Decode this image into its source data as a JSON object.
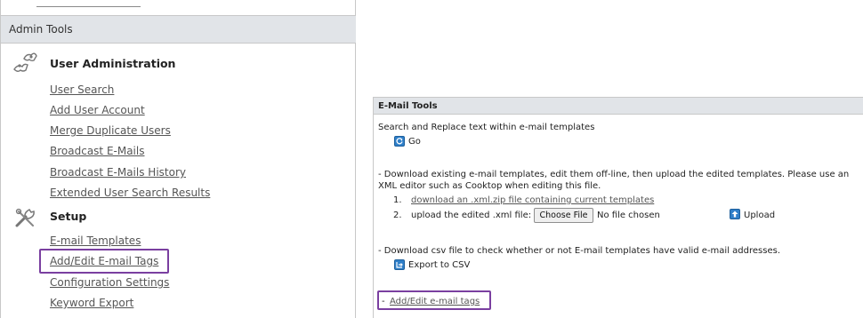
{
  "left": {
    "header": "Admin Tools",
    "sections": [
      {
        "title": "User Administration",
        "icon": "users-puzzle-icon",
        "links": [
          "User Search",
          "Add User Account",
          "Merge Duplicate Users",
          "Broadcast E-Mails",
          "Broadcast E-Mails History",
          "Extended User Search Results"
        ]
      },
      {
        "title": "Setup",
        "icon": "tools-icon",
        "links": [
          "E-mail Templates",
          "Add/Edit E-mail Tags",
          "Configuration Settings",
          "Keyword Export"
        ]
      }
    ]
  },
  "right": {
    "header": "E-Mail Tools",
    "search_replace_text": "Search and Replace text within e-mail templates",
    "go_label": "Go",
    "download_text_1": "- Download existing e-mail templates, edit them off-line, then upload the edited templates. Please use an",
    "download_text_2": "XML editor such as Cooktop when editing this file.",
    "step1_num": "1.",
    "step1_link": "download an .xml.zip file containing current templates",
    "step2_num": "2.",
    "step2_text": "upload the edited .xml file:",
    "choose_file_label": "Choose File",
    "no_file_text": "No file chosen",
    "upload_label": "Upload",
    "csv_text": "- Download csv file to check whether or not E-mail templates have valid e-mail addresses.",
    "export_label": "Export to CSV",
    "tags_prefix": "- ",
    "tags_link": "Add/Edit e-mail tags"
  },
  "colors": {
    "highlight": "#7a3fa0",
    "icon_blue": "#2f7fc9",
    "header_bg": "#e1e4e8"
  }
}
